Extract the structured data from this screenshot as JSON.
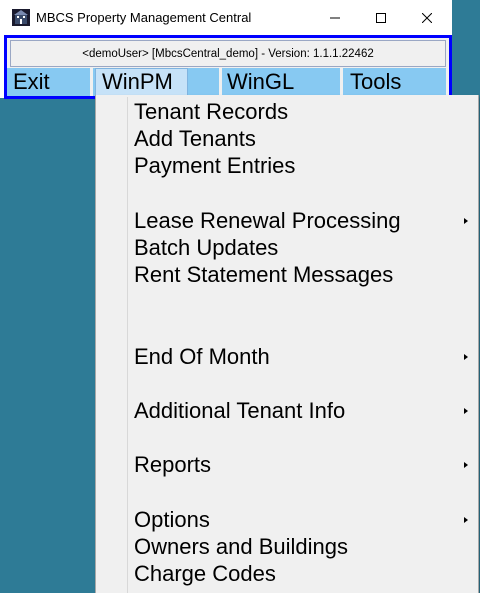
{
  "window": {
    "title": "MBCS Property Management Central",
    "status": "<demoUser> [MbcsCentral_demo] - Version: 1.1.1.22462"
  },
  "menubar": {
    "items": [
      {
        "label": "Exit"
      },
      {
        "label": "WinPM"
      },
      {
        "label": "WinGL"
      },
      {
        "label": "Tools"
      }
    ]
  },
  "winpm_menu": {
    "items": [
      {
        "label": "Tenant Records",
        "submenu": false
      },
      {
        "label": "Add Tenants",
        "submenu": false
      },
      {
        "label": "Payment Entries",
        "submenu": false
      },
      {
        "label": "Lease Renewal Processing",
        "submenu": true
      },
      {
        "label": "Batch Updates",
        "submenu": false
      },
      {
        "label": "Rent Statement Messages",
        "submenu": false
      },
      {
        "label": "End Of Month",
        "submenu": true
      },
      {
        "label": "Additional Tenant Info",
        "submenu": true
      },
      {
        "label": "Reports",
        "submenu": true
      },
      {
        "label": "Options",
        "submenu": true
      },
      {
        "label": "Owners and Buildings",
        "submenu": false
      },
      {
        "label": "Charge Codes",
        "submenu": false
      }
    ]
  },
  "colors": {
    "desktop": "#2e7b96",
    "menubar": "#87c9f2",
    "client_border": "#0000ff"
  }
}
